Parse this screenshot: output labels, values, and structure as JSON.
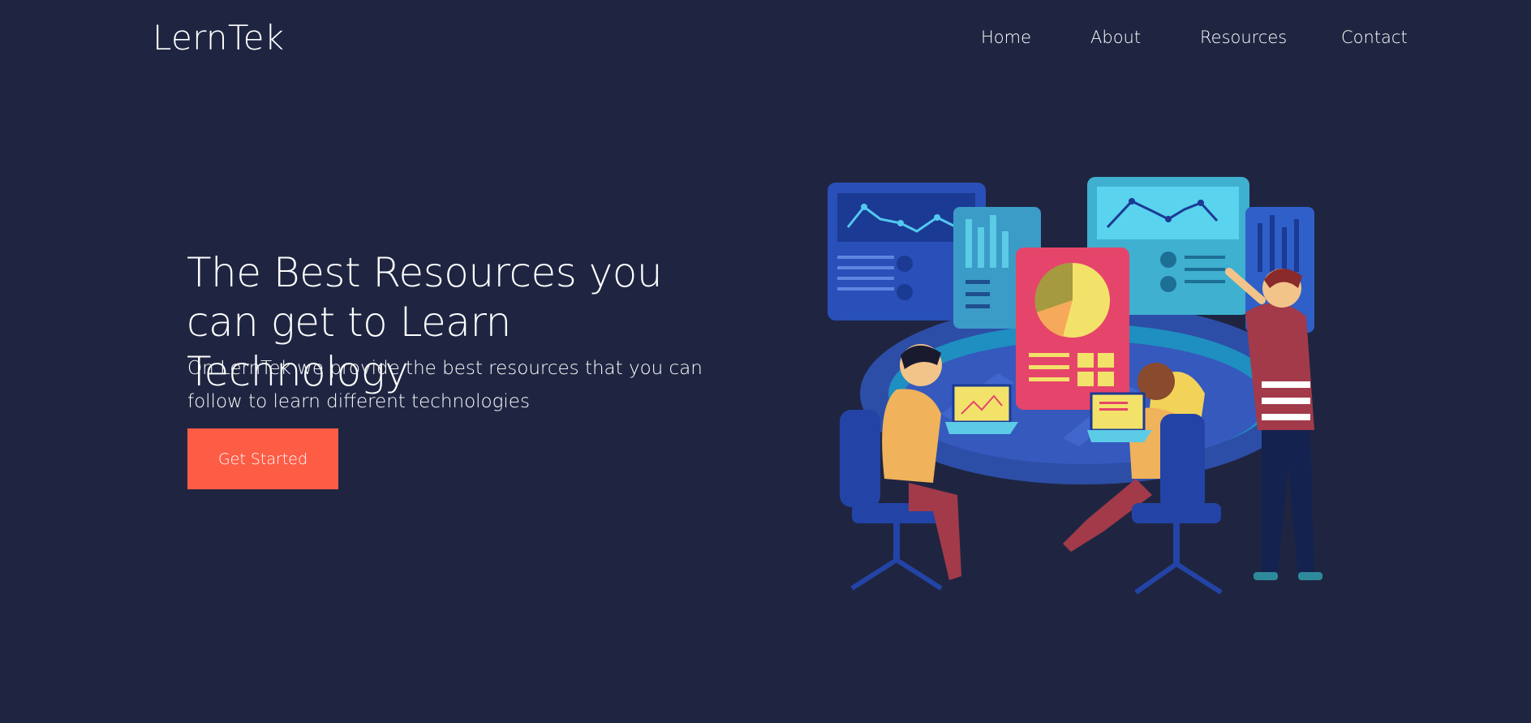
{
  "brand": {
    "name": "LernTek"
  },
  "nav": {
    "items": [
      {
        "label": "Home"
      },
      {
        "label": "About"
      },
      {
        "label": "Resources"
      },
      {
        "label": "Contact"
      }
    ]
  },
  "hero": {
    "title": "The Best Resources you can get to Learn Technology",
    "subtitle": "On LernTek we provide the best resources that you can follow to learn different technologies",
    "cta_label": "Get Started"
  },
  "colors": {
    "background": "#1f2541",
    "accent": "#fd5c45",
    "text": "#ffffff"
  }
}
